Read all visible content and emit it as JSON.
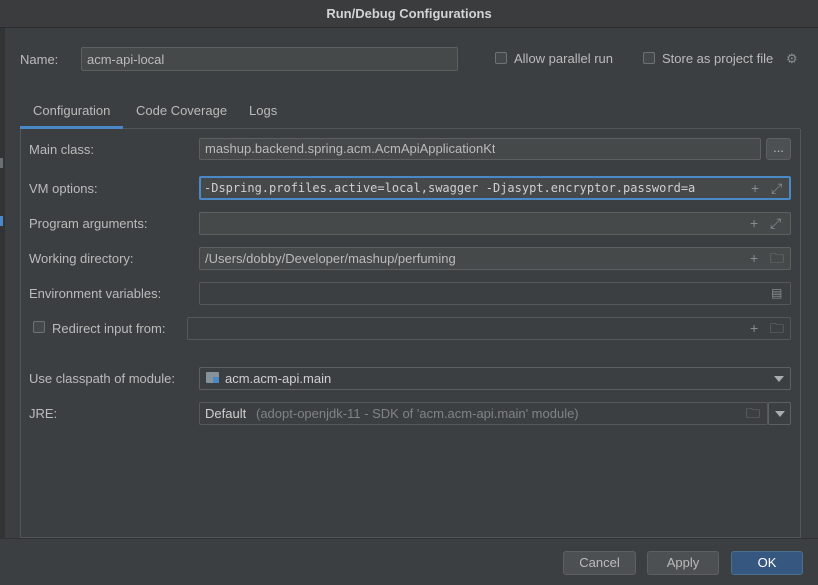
{
  "window": {
    "title": "Run/Debug Configurations"
  },
  "name_row": {
    "label": "Name:",
    "value": "acm-api-local"
  },
  "options": {
    "allow_parallel_label": "Allow parallel run",
    "store_project_label": "Store as project file"
  },
  "tabs": [
    {
      "label": "Configuration",
      "selected": true
    },
    {
      "label": "Code Coverage",
      "selected": false
    },
    {
      "label": "Logs",
      "selected": false
    }
  ],
  "form": {
    "main_class": {
      "label": "Main class:",
      "value": "mashup.backend.spring.acm.AcmApiApplicationKt",
      "browse_label": "..."
    },
    "vm_options": {
      "label": "VM options:",
      "value": "-Dspring.profiles.active=local,swagger -Djasypt.encryptor.password=a"
    },
    "program_args": {
      "label": "Program arguments:",
      "value": ""
    },
    "working_dir": {
      "label": "Working directory:",
      "value": "/Users/dobby/Developer/mashup/perfuming"
    },
    "env_vars": {
      "label": "Environment variables:",
      "value": ""
    },
    "redirect_input": {
      "label": "Redirect input from:",
      "value": ""
    },
    "classpath_module": {
      "label": "Use classpath of module:",
      "value": "acm.acm-api.main"
    },
    "jre": {
      "label": "JRE:",
      "value": "Default",
      "hint": "(adopt-openjdk-11 - SDK of 'acm.acm-api.main' module)"
    }
  },
  "buttons": {
    "cancel": "Cancel",
    "apply": "Apply",
    "ok": "OK"
  },
  "colors": {
    "accent": "#4a88c7",
    "default_button": "#365880",
    "background": "#3c3f41",
    "field": "#45494a"
  }
}
